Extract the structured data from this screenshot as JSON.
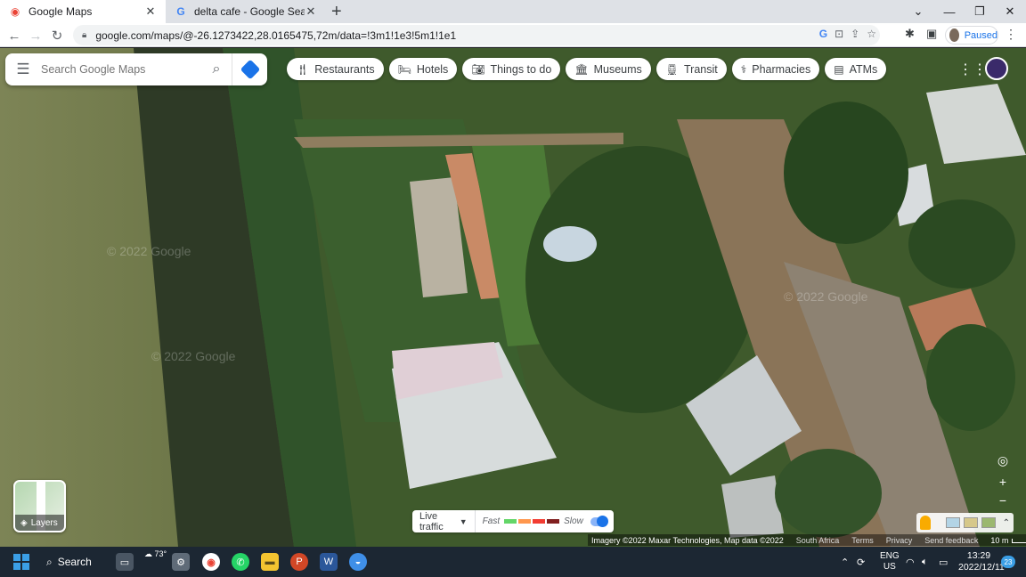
{
  "browser": {
    "tabs": [
      {
        "label": "Google Maps",
        "icon": "maps-pin-icon",
        "active": true
      },
      {
        "label": "delta cafe - Google Search",
        "icon": "google-g-icon",
        "active": false
      }
    ],
    "url": "google.com/maps/@-26.1273422,28.0165475,72m/data=!3m1!1e3!5m1!1e1",
    "profile_status": "Paused"
  },
  "maps": {
    "search_placeholder": "Search Google Maps",
    "chips": [
      {
        "label": "Restaurants",
        "icon": "fork-knife-icon"
      },
      {
        "label": "Hotels",
        "icon": "bed-icon"
      },
      {
        "label": "Things to do",
        "icon": "camera-icon"
      },
      {
        "label": "Museums",
        "icon": "museum-icon"
      },
      {
        "label": "Transit",
        "icon": "train-icon"
      },
      {
        "label": "Pharmacies",
        "icon": "pharmacy-icon"
      },
      {
        "label": "ATMs",
        "icon": "atm-icon"
      }
    ],
    "layers_label": "Layers",
    "traffic": {
      "label": "Live traffic",
      "fast": "Fast",
      "slow": "Slow",
      "colors": [
        "#63d668",
        "#ff974d",
        "#f23c32",
        "#811f1f"
      ]
    },
    "watermarks": [
      "© 2022 Google",
      "© 2022 Google",
      "© 2022 Google"
    ],
    "attribution": {
      "imagery": "Imagery ©2022 Maxar Technologies, Map data ©2022",
      "region": "South Africa",
      "terms": "Terms",
      "privacy": "Privacy",
      "feedback": "Send feedback",
      "scale": "10 m"
    }
  },
  "taskbar": {
    "search_label": "Search",
    "weather": "73°",
    "lang_line1": "ENG",
    "lang_line2": "US",
    "time": "13:29",
    "date": "2022/12/11",
    "notifications": "23"
  }
}
